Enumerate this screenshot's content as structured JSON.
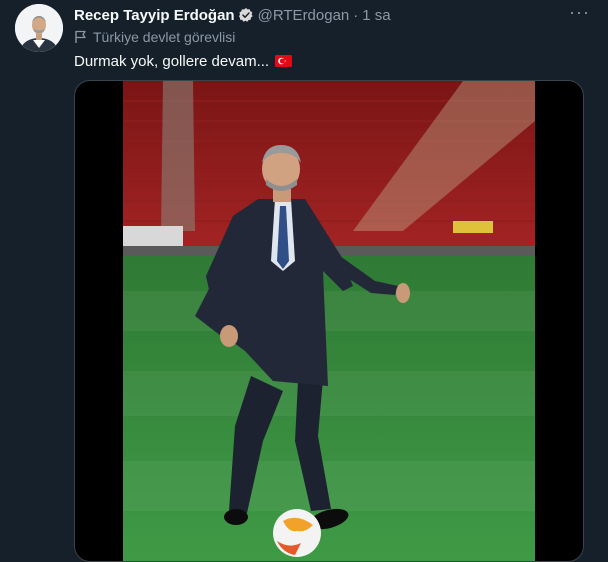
{
  "tweet": {
    "author_name": "Recep Tayyip Erdoğan",
    "handle": "@RTErdogan",
    "separator": "·",
    "time": "1 sa",
    "more_label": "···",
    "account_label": "Türkiye devlet görevlisi",
    "text": "Durmak yok, gollere devam...",
    "icons": [
      "verified-badge-icon",
      "flag-outline-icon",
      "turkey-flag-emoji",
      "more-options-icon"
    ],
    "colors": {
      "background": "#15202b",
      "secondary_text": "#8b98a5",
      "verified": "#1d9bf0",
      "turkey_red": "#e30a17"
    }
  }
}
